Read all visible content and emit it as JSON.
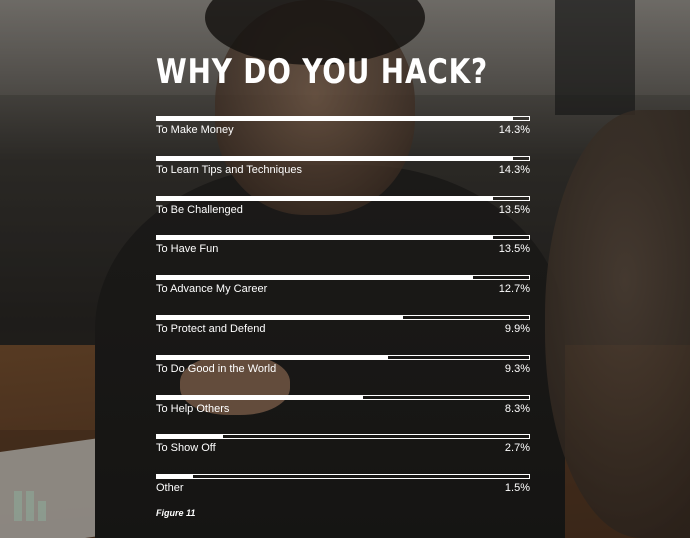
{
  "chart_data": {
    "type": "bar",
    "title": "WHY DO YOU HACK?",
    "orientation": "horizontal",
    "categories": [
      "To Make Money",
      "To Learn Tips and Techniques",
      "To Be Challenged",
      "To Have Fun",
      "To Advance My Career",
      "To Protect and Defend",
      "To Do Good in the World",
      "To Help Others",
      "To Show Off",
      "Other"
    ],
    "values": [
      14.3,
      14.3,
      13.5,
      13.5,
      12.7,
      9.9,
      9.3,
      8.3,
      2.7,
      1.5
    ],
    "value_labels": [
      "14.3%",
      "14.3%",
      "13.5%",
      "13.5%",
      "12.7%",
      "9.9%",
      "9.3%",
      "8.3%",
      "2.7%",
      "1.5%"
    ],
    "xlim": [
      0,
      15
    ],
    "grid": false,
    "legend": "none",
    "bar_color": "#ffffff"
  },
  "caption": "Figure 11"
}
